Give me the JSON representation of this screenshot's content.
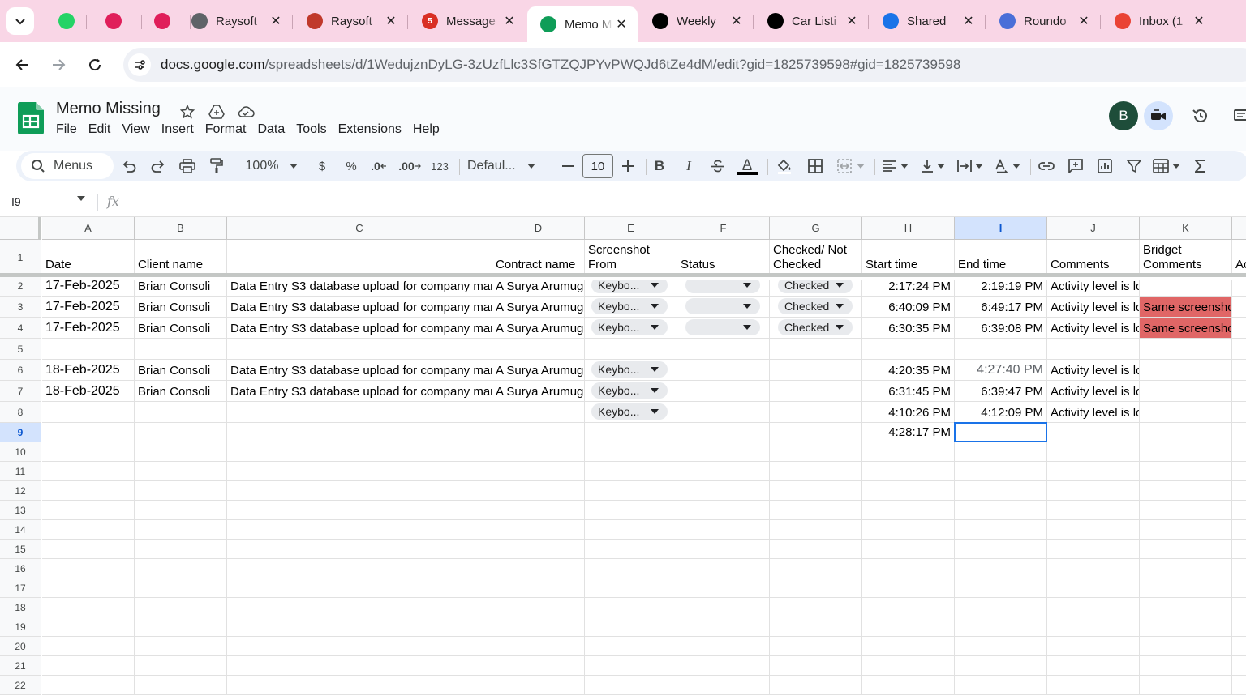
{
  "browser": {
    "tabs": [
      {
        "title": "",
        "icon": "whatsapp-icon",
        "color": "#25d366"
      },
      {
        "title": "",
        "icon": "slack-icon",
        "color": "#e01e5a"
      },
      {
        "title": "",
        "icon": "slack-icon",
        "color": "#e01e5a"
      },
      {
        "title": "Raysoft",
        "icon": "globe-icon",
        "color": "#5f6368"
      },
      {
        "title": "Raysoft",
        "icon": "raysoft-icon",
        "color": "#c0392b"
      },
      {
        "title": "Message",
        "icon": "message-icon",
        "color": "#d93025",
        "badge": "5"
      },
      {
        "title": "Memo M",
        "icon": "sheets-icon",
        "color": "#0f9d58",
        "active": true
      },
      {
        "title": "Weekly",
        "icon": "upwork-icon",
        "color": "#000000"
      },
      {
        "title": "Car Listi",
        "icon": "upwork-icon",
        "color": "#000000"
      },
      {
        "title": "Shared",
        "icon": "drive-icon",
        "color": "#1a73e8"
      },
      {
        "title": "Roundo",
        "icon": "roundo-icon",
        "color": "#4a6fd8"
      },
      {
        "title": "Inbox (1",
        "icon": "gmail-icon",
        "color": "#ea4335"
      }
    ],
    "url_domain": "docs.google.com",
    "url_path": "/spreadsheets/d/1WedujznDyLG-3zUzfLlc3SfGTZQJPYvPWQJd6tZe4dM/edit?gid=1825739598#gid=1825739598"
  },
  "doc": {
    "title": "Memo Missing",
    "menus": [
      "File",
      "Edit",
      "View",
      "Insert",
      "Format",
      "Data",
      "Tools",
      "Extensions",
      "Help"
    ],
    "avatar_letter": "B"
  },
  "toolbar": {
    "search": "Menus",
    "zoom": "100%",
    "currency": "$",
    "percent": "%",
    "dec_less": ".0",
    "dec_more": ".00",
    "number_format": "123",
    "font": "Defaul...",
    "font_size": "10",
    "bold": "B",
    "italic": "I",
    "text_color": "A"
  },
  "formula_bar": {
    "cell_ref": "I9",
    "fx": "fx",
    "value": ""
  },
  "sheet": {
    "columns": [
      "A",
      "B",
      "C",
      "D",
      "E",
      "F",
      "G",
      "H",
      "I",
      "J",
      "K"
    ],
    "selected_column": "I",
    "selected_row": "9",
    "row_numbers": [
      "1",
      "2",
      "3",
      "4",
      "5",
      "6",
      "7",
      "8",
      "9",
      "10",
      "11",
      "12",
      "13",
      "14",
      "15",
      "16",
      "17",
      "18",
      "19",
      "20",
      "21",
      "22"
    ],
    "header_row": [
      "Date",
      "Client name",
      "",
      "Contract name",
      "Screenshot From",
      "Status",
      "Checked/ Not Checked",
      "Start time",
      "End time",
      "Comments",
      "Bridget Comments",
      "Ac"
    ],
    "rows": [
      {
        "A": "17-Feb-2025",
        "B": "Brian Consoli",
        "C": "Data Entry S3 database upload for company man",
        "D": "A Surya Arumug",
        "E": "Keybo...",
        "F": "",
        "G": "Checked",
        "H": "2:17:24 PM",
        "I": "2:19:19 PM",
        "J": "Activity level is lo",
        "K": ""
      },
      {
        "A": "17-Feb-2025",
        "B": "Brian Consoli",
        "C": "Data Entry S3 database upload for company man",
        "D": "A Surya Arumug",
        "E": "Keybo...",
        "F": "",
        "G": "Checked",
        "H": "6:40:09 PM",
        "I": "6:49:17 PM",
        "J": "Activity level is lo",
        "K": "Same screenshot"
      },
      {
        "A": "17-Feb-2025",
        "B": "Brian Consoli",
        "C": "Data Entry S3 database upload for company man",
        "D": "A Surya Arumug",
        "E": "Keybo...",
        "F": "",
        "G": "Checked",
        "H": "6:30:35 PM",
        "I": "6:39:08 PM",
        "J": "Activity level is lo",
        "K": "Same screenshot"
      },
      {
        "A": "",
        "B": "",
        "C": "",
        "D": "",
        "E": "",
        "F": "",
        "G": "",
        "H": "",
        "I": "",
        "J": "",
        "K": ""
      },
      {
        "A": "18-Feb-2025",
        "B": "Brian Consoli",
        "C": "Data Entry S3 database upload for company man",
        "D": "A Surya Arumug",
        "E": "Keybo...",
        "F": "",
        "G": "",
        "H": "4:20:35 PM",
        "I": "4:27:40 PM",
        "J": "Activity level is lo",
        "K": ""
      },
      {
        "A": "18-Feb-2025",
        "B": "Brian Consoli",
        "C": "Data Entry S3 database upload for company man",
        "D": "A Surya Arumug",
        "E": "Keybo...",
        "F": "",
        "G": "",
        "H": "6:31:45 PM",
        "I": "6:39:47 PM",
        "J": "Activity level is lo",
        "K": ""
      },
      {
        "A": "",
        "B": "",
        "C": "",
        "D": "",
        "E": "Keybo...",
        "F": "",
        "G": "",
        "H": "4:10:26 PM",
        "I": "4:12:09 PM",
        "J": "Activity level is lo",
        "K": ""
      },
      {
        "A": "",
        "B": "",
        "C": "",
        "D": "",
        "E": "",
        "F": "",
        "G": "",
        "H": "4:28:17 PM",
        "I": "",
        "J": "",
        "K": ""
      }
    ],
    "colors": {
      "red_fill": "#e06666",
      "selection": "#1a73e8"
    }
  }
}
